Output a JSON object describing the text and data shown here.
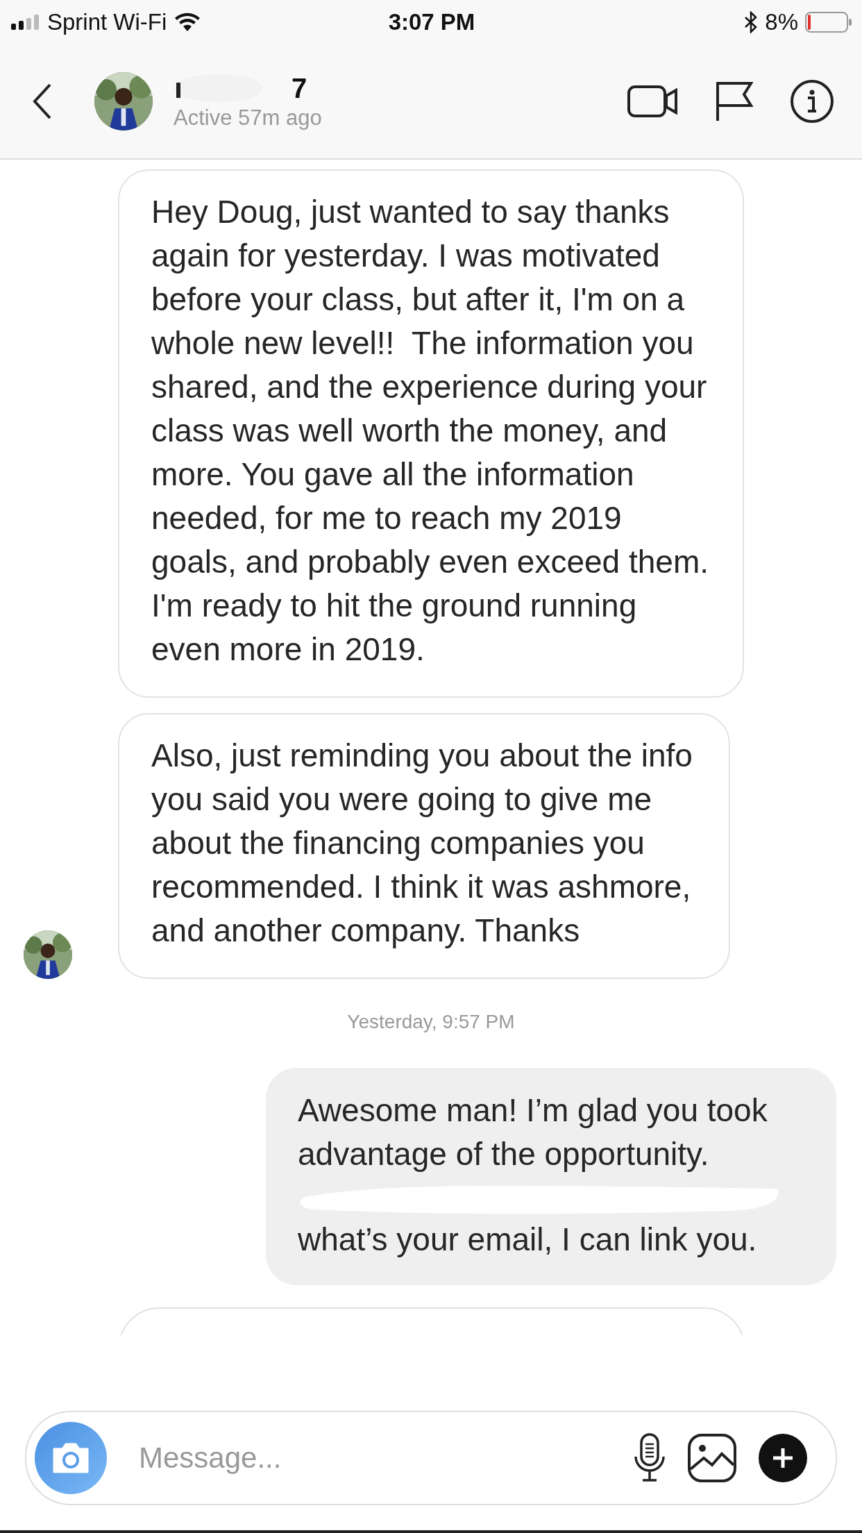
{
  "status_bar": {
    "carrier": "Sprint Wi-Fi",
    "time": "3:07 PM",
    "battery": "8%"
  },
  "header": {
    "name": "7",
    "status": "Active 57m ago",
    "name_redacted": true
  },
  "messages": [
    {
      "kind": "incoming",
      "text": "Hey Doug, just wanted to say thanks again for yesterday. I was motivated before your class, but after it, I'm on a whole new level!!  The information you shared, and the experience during your class was well worth the money, and more. You gave all the information needed, for me to reach my 2019 goals, and probably even exceed them. I'm ready to hit the ground running even more in 2019.",
      "avatar": false
    },
    {
      "kind": "incoming",
      "text": "Also, just reminding you about the info you said you were going to give me about the financing companies you recommended. I think it was ashmore, and another company. Thanks",
      "avatar": true
    },
    {
      "kind": "timestamp",
      "text": "Yesterday, 9:57 PM"
    },
    {
      "kind": "outgoing",
      "lines": [
        "Awesome man! I’m glad you took advantage of the opportunity.",
        "what’s your email, I can link you."
      ],
      "redacted": true
    }
  ],
  "composer": {
    "placeholder": "Message..."
  }
}
